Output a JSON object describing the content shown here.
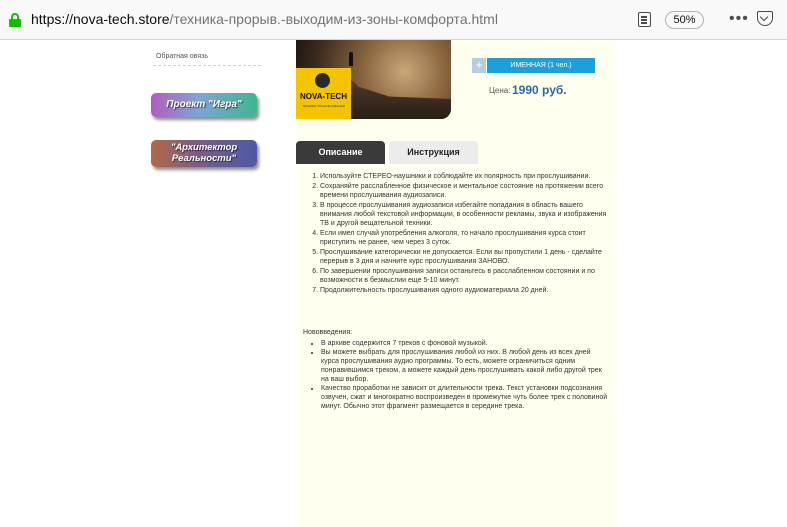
{
  "browser": {
    "url_host": "https://nova-tech.store",
    "url_path": "/техника-прорыв.-выходим-из-зоны-комфорта.html",
    "zoom": "50%"
  },
  "sidebar": {
    "feedback_link": "Обратная овязь",
    "buttons": [
      {
        "label": "Проект \"Игра\""
      },
      {
        "label": "\"Архитектор Реальности\""
      }
    ]
  },
  "product": {
    "logo_text": "NOVA-TECH",
    "logo_subtext": "ТЕХНИКИ ТРАНСФОРМАЦИИ",
    "variant": "ИМЕННАЯ (1 чел.)",
    "plus_label": "+",
    "price_label": "Цена:",
    "price_value": "1990 руб."
  },
  "tabs": [
    {
      "label": "Описание"
    },
    {
      "label": "Инструкция"
    }
  ],
  "instructions": [
    "Используйте СТЕРЕО-наушники и соблюдайте их полярность при прослушивании.",
    "Сохраняйте расслабленное физическое и ментальное состояние на протяжении всего времени прослушивания аудиозаписи.",
    "В процессе прослушивания аудиозаписи избегайте попадания в область вашего внимания любой текстовой информации, в особенности рекламы, звука и изображения ТВ и другой вещательной техники.",
    "Если имел случай употребления алкоголя, то начало прослушивания курса стоит приступить не ранее, чем через 3 суток.",
    "Прослушивание категорически не допускается. Если вы пропустили 1 день - сделайте перерыв в 3 дня и начните курс прослушивания ЗАНОВО.",
    "По завершении прослушивания записи останьтесь в расслабленном состоянии и по возможности в безмыслии еще 5-10 минут.",
    "Продолжительность прослушивания одного аудиоматериала 20 дней."
  ],
  "notes": {
    "title": "Нововведения:",
    "items": [
      "В архиве содержится 7 треков с фоновой музыкой.",
      "Вы можете выбрать для прослушивания любой из них. В любой день из всех дней курса прослушивания аудио программы. То есть, можете ограничиться одним понравившимся треком, а можете каждый день прослушивать какой либо другой трек на ваш выбор.",
      "Качество проработки не зависит от длительности трека. Текст установки подсознания озвучен, сжат и многократно воспроизведен в промежутке чуть более трех с половиной минут. Обычно этот фрагмент размещается в середине трека."
    ]
  }
}
